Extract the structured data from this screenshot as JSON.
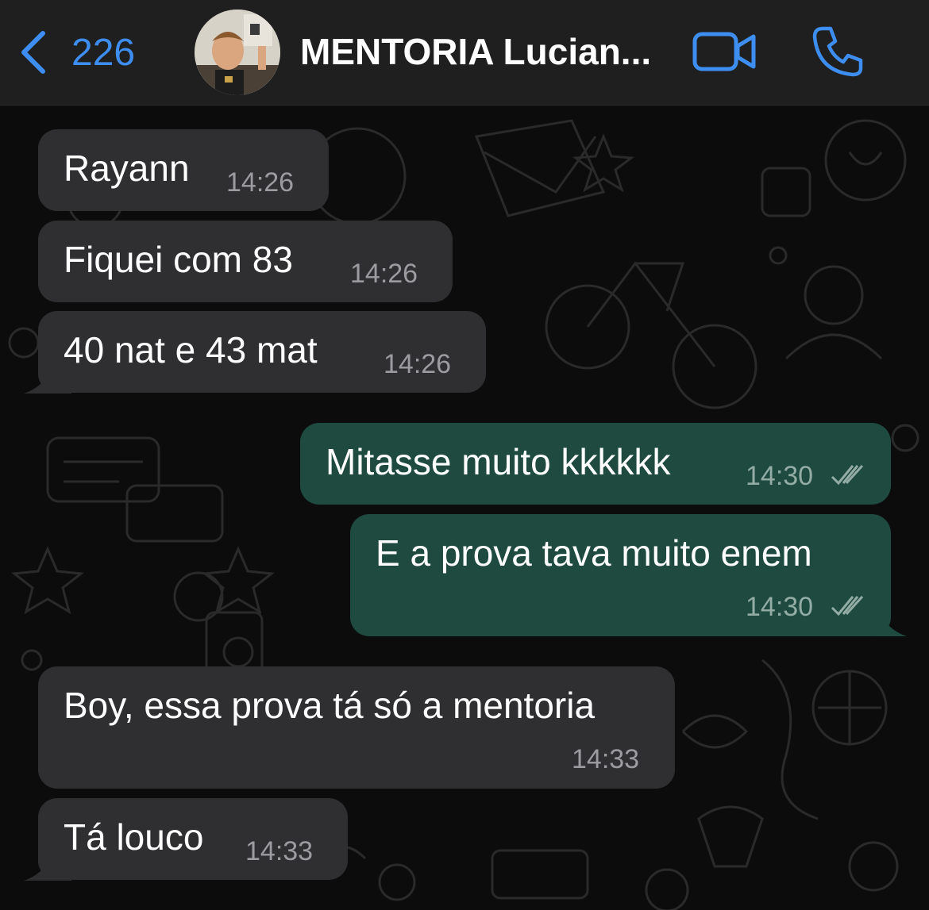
{
  "header": {
    "back_count": "226",
    "title": "MENTORIA Lucian...",
    "avatar_icon": "profile-photo",
    "video_icon": "video-camera-icon",
    "call_icon": "phone-icon",
    "accent_color": "#3d8ef0"
  },
  "messages": [
    {
      "direction": "in",
      "text": "Rayann",
      "time": "14:26"
    },
    {
      "direction": "in",
      "text": "Fiquei com 83",
      "time": "14:26"
    },
    {
      "direction": "in",
      "text": "40 nat e 43 mat",
      "time": "14:26"
    },
    {
      "direction": "out",
      "text": "Mitasse muito kkkkkk",
      "time": "14:30",
      "status": "read"
    },
    {
      "direction": "out",
      "text": "E a prova tava muito enem",
      "time": "14:30",
      "status": "read"
    },
    {
      "direction": "in",
      "text": "Boy, essa prova tá só a mentoria",
      "time": "14:33"
    },
    {
      "direction": "in",
      "text": "Tá louco",
      "time": "14:33"
    }
  ],
  "colors": {
    "incoming_bubble": "#2f2f31",
    "outgoing_bubble": "#1e4a3f",
    "header_bg": "#1f1f1f",
    "chat_bg": "#0c0c0c"
  }
}
